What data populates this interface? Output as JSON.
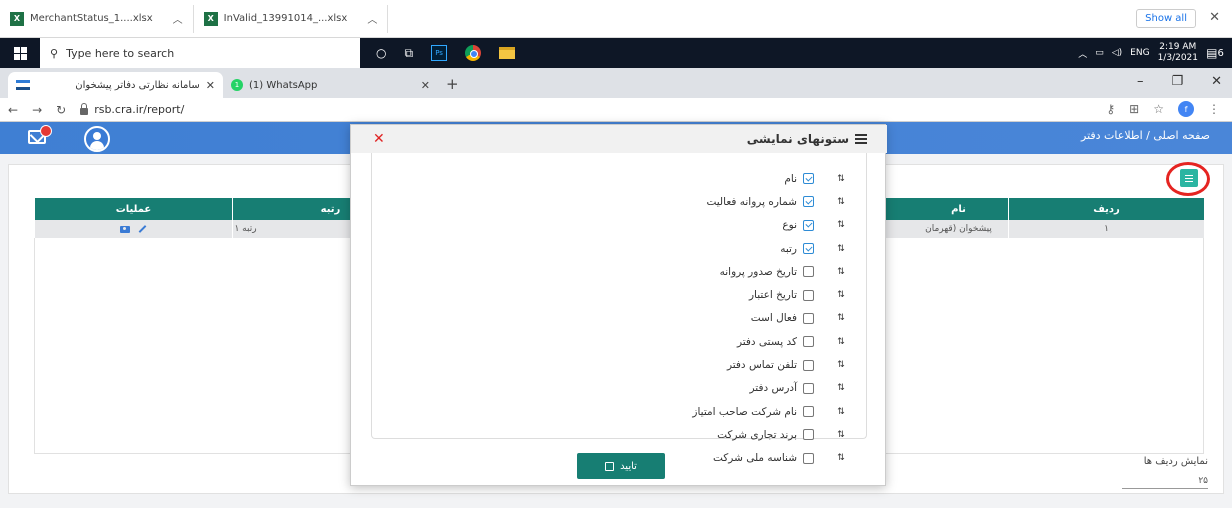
{
  "downloads": {
    "items": [
      {
        "name": "MerchantStatus_1....xlsx"
      },
      {
        "name": "InValid_13991014_...xlsx"
      }
    ],
    "show_all": "Show all",
    "close": "✕"
  },
  "taskbar": {
    "search_placeholder": "Type here to search",
    "language": "ENG",
    "time": "2:19 AM",
    "date": "1/3/2021",
    "notifications": "6"
  },
  "browser": {
    "tabs": [
      {
        "title": "سامانه نظارتی دفاتر پیشخوان",
        "active": true
      },
      {
        "title": "(1) WhatsApp",
        "active": false
      }
    ],
    "url": "rsb.cra.ir/report/",
    "profile_initial": "f"
  },
  "header": {
    "breadcrumb": "صفحه اصلی / اطلاعات دفتر"
  },
  "table": {
    "columns": [
      "ردیف",
      "نام",
      "رتبه",
      "عملیات"
    ],
    "rows": [
      {
        "index": "۱",
        "name": "پیشخوان (قهرمان",
        "rank": "رتبه ۱"
      }
    ]
  },
  "rows_per_page": {
    "label": "نمایش ردیف ها",
    "value": "۲۵"
  },
  "modal": {
    "title": "ستونهای نمایشی",
    "close": "✕",
    "confirm": "تایید",
    "columns": [
      {
        "label": "نام",
        "checked": true
      },
      {
        "label": "شماره پروانه فعالیت",
        "checked": true
      },
      {
        "label": "نوع",
        "checked": true
      },
      {
        "label": "رتبه",
        "checked": true
      },
      {
        "label": "تاریخ صدور پروانه",
        "checked": false
      },
      {
        "label": "تاریخ اعتبار",
        "checked": false
      },
      {
        "label": "فعال است",
        "checked": false
      },
      {
        "label": "کد پستی دفتر",
        "checked": false
      },
      {
        "label": "تلفن تماس دفتر",
        "checked": false
      },
      {
        "label": "آدرس دفتر",
        "checked": false
      },
      {
        "label": "نام شرکت صاحب امتیاز",
        "checked": false
      },
      {
        "label": "برند تجاری شرکت",
        "checked": false
      },
      {
        "label": "شناسه ملی شرکت",
        "checked": false
      }
    ]
  },
  "colors": {
    "header_blue": "#3a7bd5",
    "table_teal": "#177e73",
    "annotation_red": "#e52421"
  }
}
